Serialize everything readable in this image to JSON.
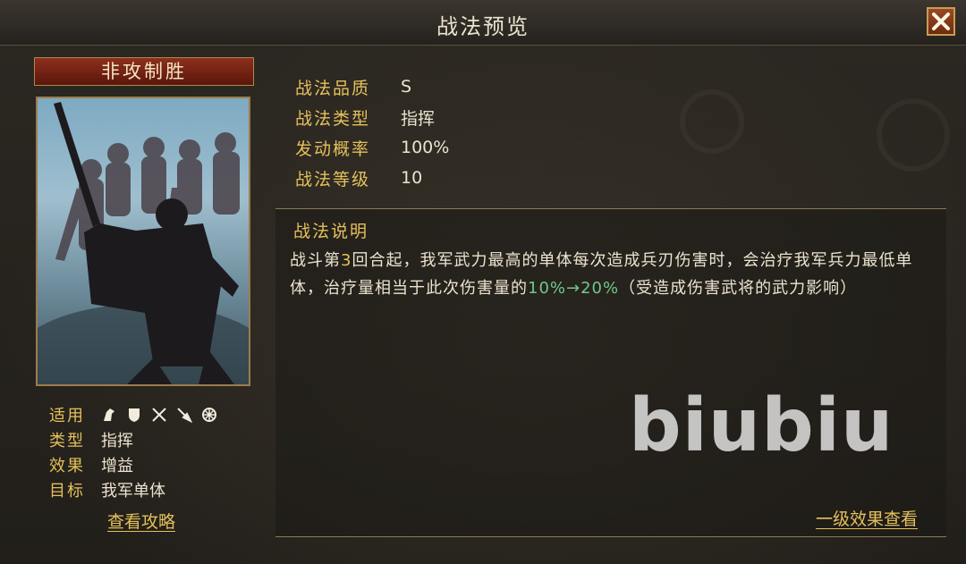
{
  "window": {
    "title": "战法预览"
  },
  "card": {
    "name": "非攻制胜",
    "meta": [
      {
        "label": "适用",
        "icons": [
          "cavalry-icon",
          "shield-icon",
          "bow-icon",
          "spear-icon",
          "wheel-icon"
        ]
      },
      {
        "label": "类型",
        "value": "指挥"
      },
      {
        "label": "效果",
        "value": "增益"
      },
      {
        "label": "目标",
        "value": "我军单体"
      }
    ],
    "guide_link": "查看攻略"
  },
  "stats": [
    {
      "label": "战法品质",
      "value": "S"
    },
    {
      "label": "战法类型",
      "value": "指挥"
    },
    {
      "label": "发动概率",
      "value": "100%"
    },
    {
      "label": "战法等级",
      "value": "10"
    }
  ],
  "description": {
    "title": "战法说明",
    "part1": "战斗第",
    "round": "3",
    "part2": "回合起，我军武力最高的单体每次造成兵刃伤害时，会治疗我军兵力最低单体，治疗量相当于此次伤害量的",
    "percent": "10%→20%",
    "part3": "（受造成伤害武将的武力影响）"
  },
  "watermark": "biubiu",
  "level_link": "一级效果查看",
  "colors": {
    "accent": "#e4c05a",
    "highlight_green": "#6fc88a",
    "text": "#ece3cf",
    "name_bar": "#8c2f1d"
  }
}
